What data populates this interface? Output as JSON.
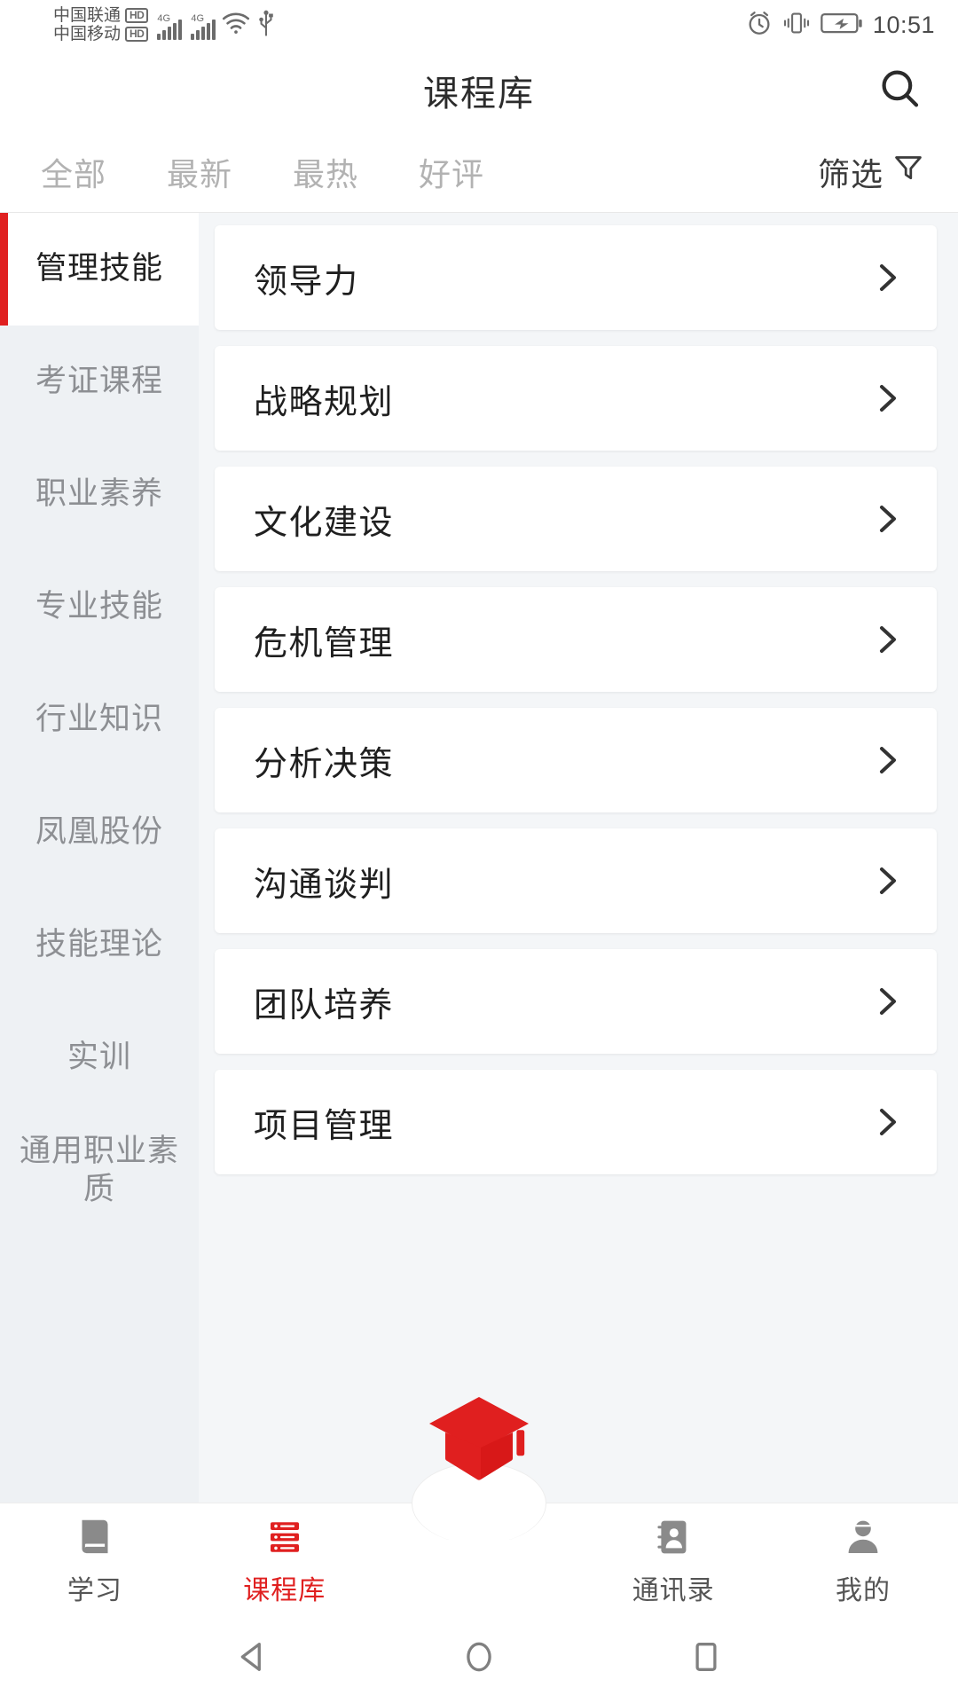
{
  "statusbar": {
    "carrier1": "中国联通",
    "carrier1_badge": "HD",
    "carrier2": "中国移动",
    "carrier2_badge": "HD",
    "net1": "4G",
    "net2": "4G",
    "icons": [
      "wifi-icon",
      "usb-icon",
      "alarm-icon",
      "vibrate-icon",
      "battery-charging-icon"
    ],
    "time": "10:51"
  },
  "header": {
    "title": "课程库",
    "search_icon": "search-icon"
  },
  "tabs": {
    "items": [
      {
        "label": "全部",
        "active": true
      },
      {
        "label": "最新",
        "active": false
      },
      {
        "label": "最热",
        "active": false
      },
      {
        "label": "好评",
        "active": false
      }
    ],
    "filter_label": "筛选",
    "filter_icon": "funnel-icon"
  },
  "sidebar": {
    "items": [
      {
        "label": "管理技能",
        "active": true
      },
      {
        "label": "考证课程",
        "active": false
      },
      {
        "label": "职业素养",
        "active": false
      },
      {
        "label": "专业技能",
        "active": false
      },
      {
        "label": "行业知识",
        "active": false
      },
      {
        "label": "凤凰股份",
        "active": false
      },
      {
        "label": "技能理论",
        "active": false
      },
      {
        "label": "实训",
        "active": false
      },
      {
        "label": "通用职业素质",
        "active": false
      }
    ]
  },
  "courses": {
    "items": [
      {
        "title": "领导力"
      },
      {
        "title": "战略规划"
      },
      {
        "title": "文化建设"
      },
      {
        "title": "危机管理"
      },
      {
        "title": "分析决策"
      },
      {
        "title": "沟通谈判"
      },
      {
        "title": "团队培养"
      },
      {
        "title": "项目管理"
      }
    ]
  },
  "bottomnav": {
    "items": [
      {
        "label": "学习",
        "icon": "book-icon",
        "active": false
      },
      {
        "label": "课程库",
        "icon": "course-stack-icon",
        "active": true
      },
      {
        "label": "通讯录",
        "icon": "contacts-icon",
        "active": false
      },
      {
        "label": "我的",
        "icon": "person-icon",
        "active": false
      }
    ],
    "fab_icon": "graduation-cap-icon"
  },
  "androidnav": {
    "back": "back-triangle-icon",
    "home": "home-circle-icon",
    "recents": "recents-square-icon"
  },
  "colors": {
    "accent": "#e02020",
    "page_bg": "#f4f6f8",
    "sidebar_bg": "#eef1f4",
    "text_primary": "#1f1f1f",
    "text_muted": "#b2b2b2"
  }
}
